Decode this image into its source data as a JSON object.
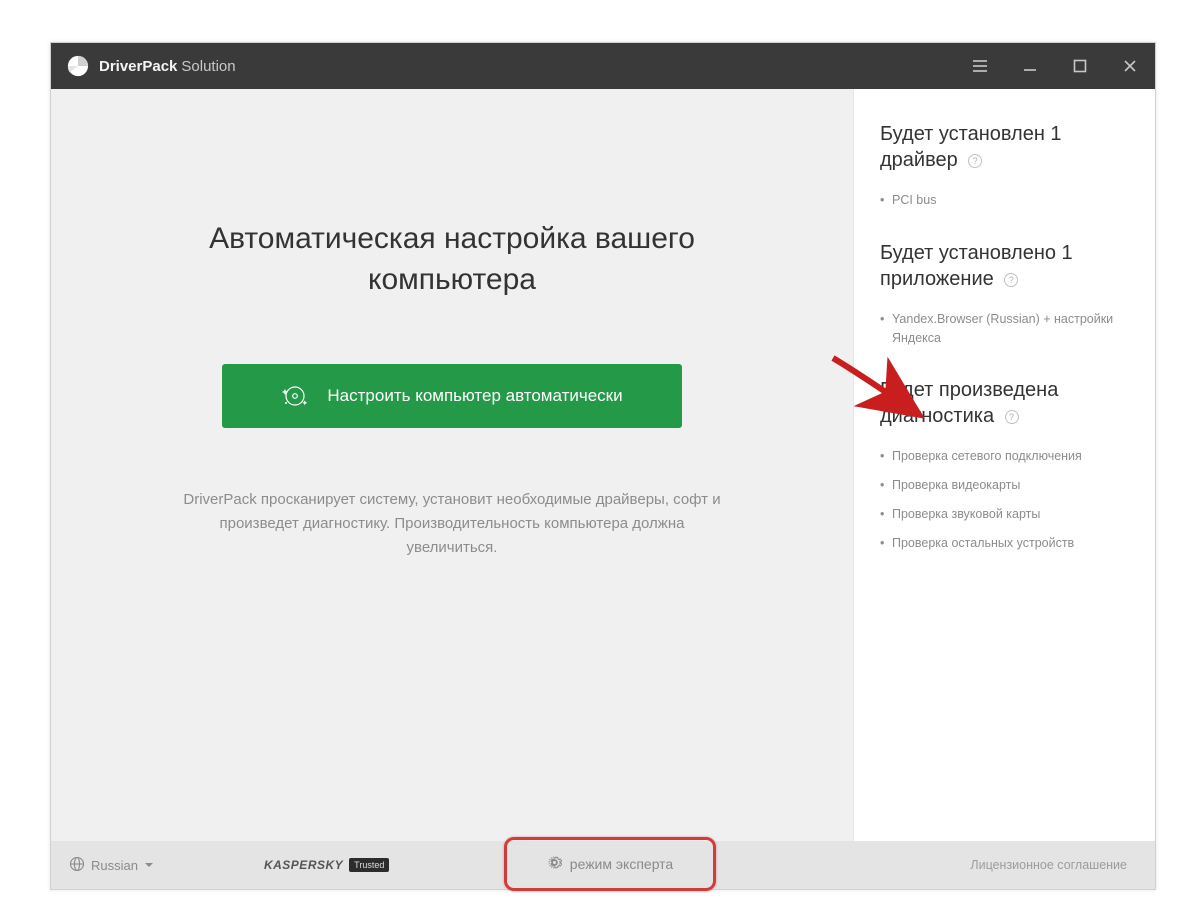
{
  "titlebar": {
    "app_name_bold": "DriverPack",
    "app_name_light": "Solution"
  },
  "main": {
    "heading": "Автоматическая настройка вашего компьютера",
    "cta_label": "Настроить компьютер автоматически",
    "description": "DriverPack просканирует систему, установит необходимые драйверы, софт и произведет диагностику. Производительность компьютера должна увеличиться."
  },
  "sidebar": {
    "drivers": {
      "title": "Будет установлен 1 драйвер",
      "items": [
        "PCI bus"
      ]
    },
    "apps": {
      "title": "Будет установлено 1 приложение",
      "items": [
        "Yandex.Browser (Russian) + настройки Яндекса"
      ]
    },
    "diagnostics": {
      "title": "Будет произведена диагностика",
      "items": [
        "Проверка сетевого подключения",
        "Проверка видеокарты",
        "Проверка звуковой карты",
        "Проверка остальных устройств"
      ]
    }
  },
  "footer": {
    "language": "Russian",
    "kaspersky": "KASPERSKY",
    "trusted": "Trusted",
    "expert_mode": "режим эксперта",
    "license": "Лицензионное соглашение"
  }
}
